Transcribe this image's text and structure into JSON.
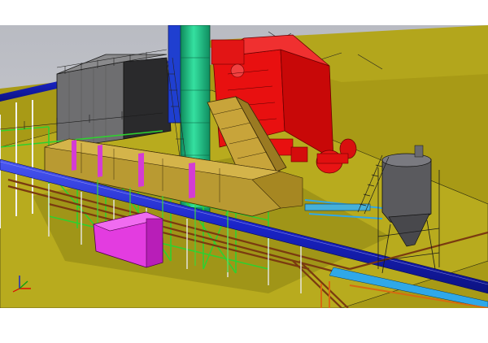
{
  "scene": {
    "kind": "3d-plant-model-render",
    "colors": {
      "sky": "#c4c6cc",
      "ground": "#a89a16",
      "platform": "#b8ab1e",
      "duct_yellow": "#b99a32",
      "duct_band": "#d43cd4",
      "stack_green": "#1fc58a",
      "stack_blue": "#1f3fd0",
      "boiler_red": "#e81010",
      "bag_filter": "#6e6e70",
      "pipe_blue": "#1a24c8",
      "pipe_brown": "#7a3a10",
      "steel_green": "#3bd63b",
      "magenta_box": "#e33ce0",
      "silo_grey": "#5a5a5e",
      "outline": "#1a1a1a"
    },
    "icons": [
      "axis-triad-icon"
    ]
  }
}
